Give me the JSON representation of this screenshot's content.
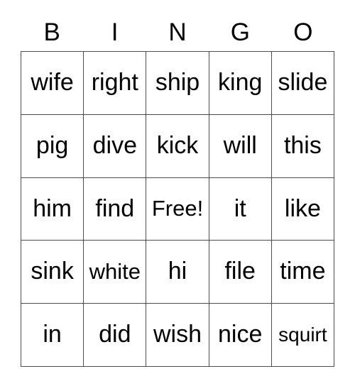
{
  "card": {
    "title_letters": [
      "B",
      "I",
      "N",
      "G",
      "O"
    ],
    "free_space_label": "Free!",
    "colors": {
      "background": "#ffffff",
      "cell_background": "#ffffff",
      "border": "#4d4d4d",
      "text": "#000000"
    },
    "rows": [
      [
        {
          "text": "wife",
          "size": "md"
        },
        {
          "text": "right",
          "size": "md"
        },
        {
          "text": "ship",
          "size": "md"
        },
        {
          "text": "king",
          "size": "md"
        },
        {
          "text": "slide",
          "size": "md"
        }
      ],
      [
        {
          "text": "pig",
          "size": "md"
        },
        {
          "text": "dive",
          "size": "md"
        },
        {
          "text": "kick",
          "size": "md"
        },
        {
          "text": "will",
          "size": "md"
        },
        {
          "text": "this",
          "size": "md"
        }
      ],
      [
        {
          "text": "him",
          "size": "md"
        },
        {
          "text": "find",
          "size": "md"
        },
        {
          "text": "Free!",
          "size": "sm"
        },
        {
          "text": "it",
          "size": "md"
        },
        {
          "text": "like",
          "size": "md"
        }
      ],
      [
        {
          "text": "sink",
          "size": "md"
        },
        {
          "text": "white",
          "size": "sm"
        },
        {
          "text": "hi",
          "size": "md"
        },
        {
          "text": "file",
          "size": "md"
        },
        {
          "text": "time",
          "size": "md"
        }
      ],
      [
        {
          "text": "in",
          "size": "md"
        },
        {
          "text": "did",
          "size": "md"
        },
        {
          "text": "wish",
          "size": "md"
        },
        {
          "text": "nice",
          "size": "md"
        },
        {
          "text": "squirt",
          "size": "xs"
        }
      ]
    ]
  }
}
